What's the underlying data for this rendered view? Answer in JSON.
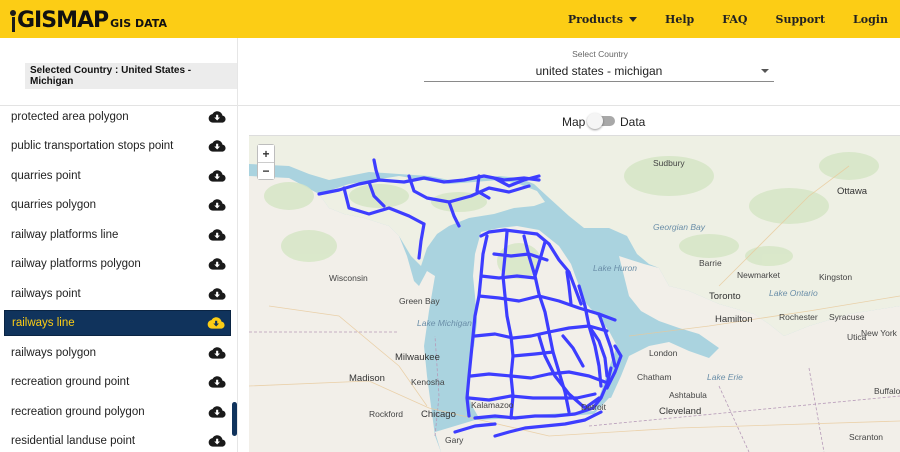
{
  "header": {
    "logo_main": "GISMAP",
    "logo_sub": "GIS DATA",
    "nav": [
      "Products",
      "Help",
      "FAQ",
      "Support",
      "Login"
    ]
  },
  "subheader": {
    "selected_country": "Selected Country : United States - Michigan",
    "select_label": "Select Country",
    "select_value": "united states - michigan"
  },
  "sidebar": {
    "items": [
      {
        "label": "protected area polygon",
        "active": false
      },
      {
        "label": "public transportation stops point",
        "active": false
      },
      {
        "label": "quarries point",
        "active": false
      },
      {
        "label": "quarries polygon",
        "active": false
      },
      {
        "label": "railway platforms line",
        "active": false
      },
      {
        "label": "railway platforms polygon",
        "active": false
      },
      {
        "label": "railways point",
        "active": false
      },
      {
        "label": "railways line",
        "active": true
      },
      {
        "label": "railways polygon",
        "active": false
      },
      {
        "label": "recreation ground point",
        "active": false
      },
      {
        "label": "recreation ground polygon",
        "active": false
      },
      {
        "label": "residential landuse point",
        "active": false
      }
    ]
  },
  "map": {
    "toggle_left": "Map",
    "toggle_right": "Data",
    "zoom_in": "+",
    "zoom_out": "−",
    "labels": [
      {
        "text": "Sudbury",
        "kind": "city"
      },
      {
        "text": "Ottawa",
        "kind": "big"
      },
      {
        "text": "Georgian Bay",
        "kind": "water"
      },
      {
        "text": "Lake Huron",
        "kind": "water"
      },
      {
        "text": "Barrie",
        "kind": "city"
      },
      {
        "text": "Newmarket",
        "kind": "city"
      },
      {
        "text": "Kingston",
        "kind": "city"
      },
      {
        "text": "Toronto",
        "kind": "big"
      },
      {
        "text": "Lake Ontario",
        "kind": "water"
      },
      {
        "text": "Hamilton",
        "kind": "big"
      },
      {
        "text": "Rochester",
        "kind": "city"
      },
      {
        "text": "Syracuse",
        "kind": "city"
      },
      {
        "text": "Utica",
        "kind": "city"
      },
      {
        "text": "New York",
        "kind": "city"
      },
      {
        "text": "London",
        "kind": "city"
      },
      {
        "text": "Buffalo",
        "kind": "city"
      },
      {
        "text": "Wisconsin",
        "kind": "city"
      },
      {
        "text": "Green Bay",
        "kind": "city"
      },
      {
        "text": "Lake Michigan",
        "kind": "water"
      },
      {
        "text": "Milwaukee",
        "kind": "big"
      },
      {
        "text": "Madison",
        "kind": "big"
      },
      {
        "text": "Kenosha",
        "kind": "city"
      },
      {
        "text": "Rockford",
        "kind": "city"
      },
      {
        "text": "Chicago",
        "kind": "big"
      },
      {
        "text": "Gary",
        "kind": "city"
      },
      {
        "text": "Kalamazoo",
        "kind": "city"
      },
      {
        "text": "Chatham",
        "kind": "city"
      },
      {
        "text": "Lake Erie",
        "kind": "water"
      },
      {
        "text": "Ashtabula",
        "kind": "city"
      },
      {
        "text": "Cleveland",
        "kind": "big"
      },
      {
        "text": "Scranton",
        "kind": "city"
      },
      {
        "text": "Detroit",
        "kind": "city"
      }
    ]
  },
  "colors": {
    "brand_yellow": "#fccd15",
    "active_navy": "#10335c",
    "rail_blue": "#3d3dff",
    "water": "#aad3df",
    "land": "#f2efe9"
  }
}
